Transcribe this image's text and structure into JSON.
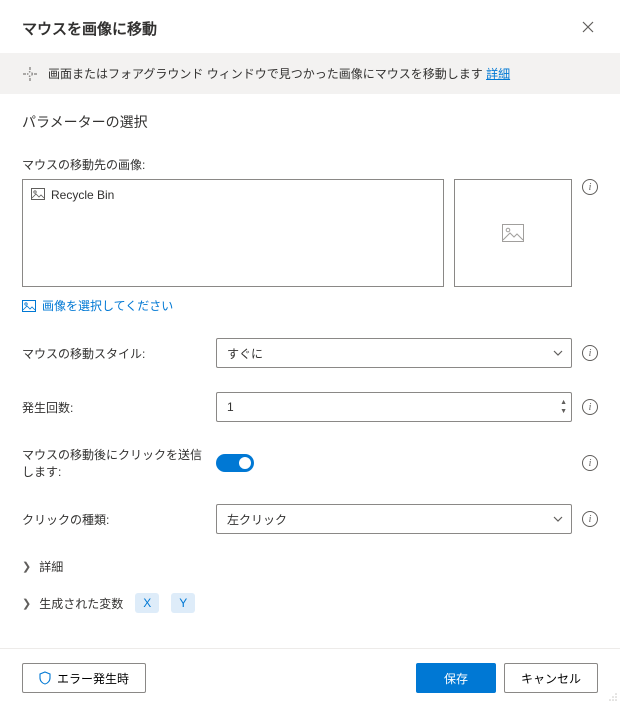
{
  "header": {
    "title": "マウスを画像に移動"
  },
  "banner": {
    "text": "画面またはフォアグラウンド ウィンドウで見つかった画像にマウスを移動します ",
    "link": "詳細"
  },
  "section": {
    "title": "パラメーターの選択"
  },
  "imageField": {
    "label": "マウスの移動先の画像:",
    "selectedName": "Recycle Bin",
    "validation": "画像を選択してください"
  },
  "moveStyle": {
    "label": "マウスの移動スタイル:",
    "value": "すぐに"
  },
  "occurrence": {
    "label": "発生回数:",
    "value": "1"
  },
  "sendClick": {
    "label": "マウスの移動後にクリックを送信します:"
  },
  "clickType": {
    "label": "クリックの種類:",
    "value": "左クリック"
  },
  "advanced": {
    "label": "詳細"
  },
  "generatedVars": {
    "label": "生成された変数",
    "vars": [
      "X",
      "Y"
    ]
  },
  "footer": {
    "onError": "エラー発生時",
    "save": "保存",
    "cancel": "キャンセル"
  }
}
